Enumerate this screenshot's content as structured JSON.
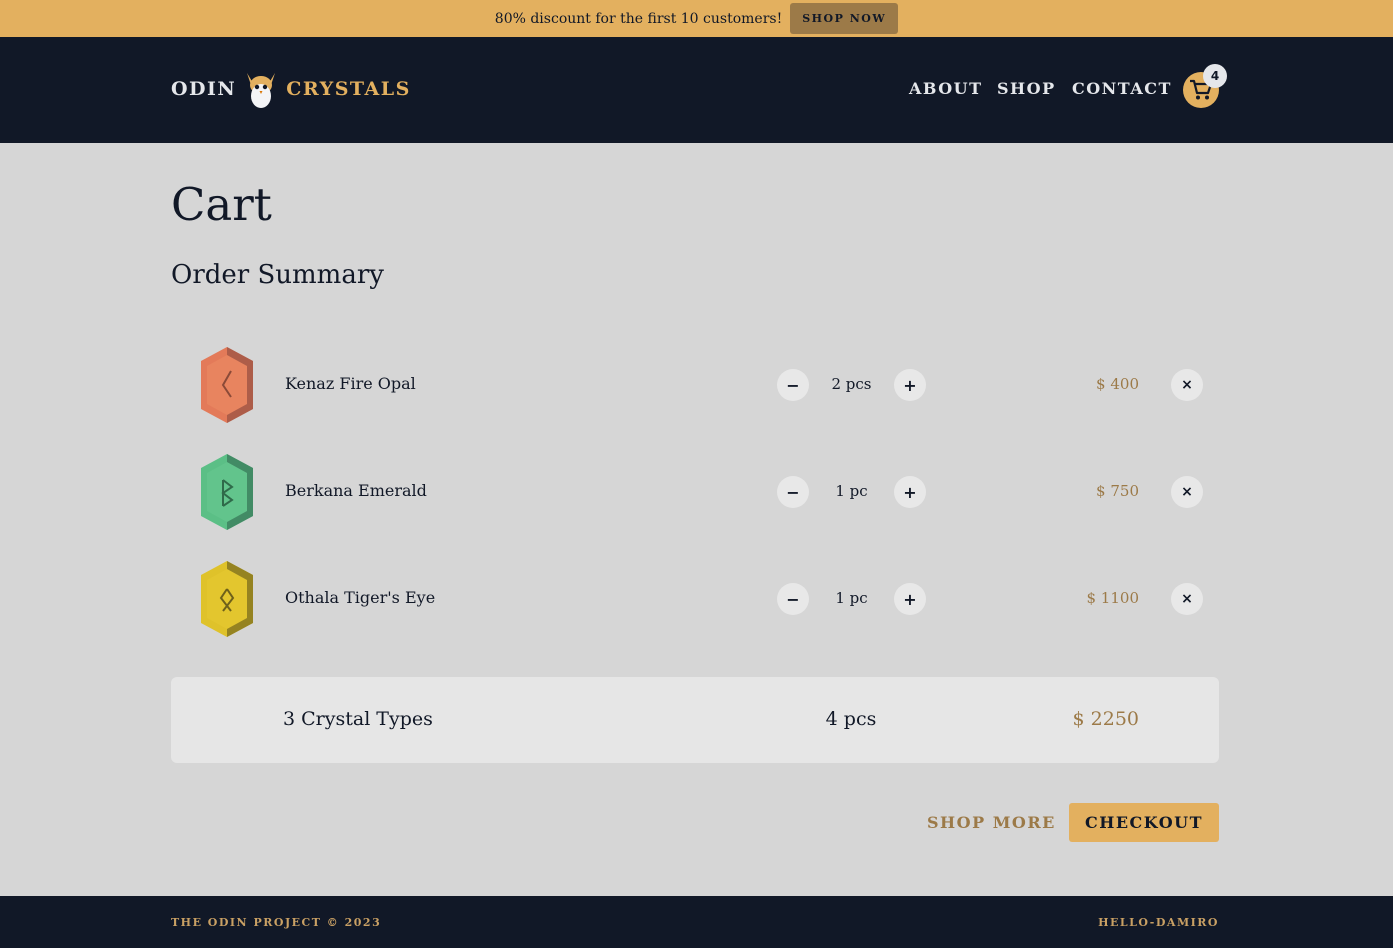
{
  "banner": {
    "text": "80% discount for the first 10 customers!",
    "button_label": "SHOP NOW"
  },
  "header": {
    "logo_left": "ODIN",
    "logo_right": "CRYSTALS",
    "nav": [
      "ABOUT",
      "SHOP",
      "CONTACT"
    ],
    "cart_count": "4",
    "mascot_icon": "viking-owl-icon",
    "cart_icon": "shopping-cart-icon"
  },
  "main": {
    "title": "Cart",
    "subtitle": "Order Summary"
  },
  "items": [
    {
      "name": "Kenaz Fire Opal",
      "qty": "2 pcs",
      "price": "$ 400",
      "gem_icon": "fire-opal-gem-icon",
      "rune": "kenaz-rune",
      "color": "#e37a59",
      "dark": "#9b5444"
    },
    {
      "name": "Berkana Emerald",
      "qty": "1 pc",
      "price": "$ 750",
      "gem_icon": "emerald-gem-icon",
      "rune": "berkana-rune",
      "color": "#5bbf86",
      "dark": "#3a7a59"
    },
    {
      "name": "Othala Tiger's Eye",
      "qty": "1 pc",
      "price": "$ 1100",
      "gem_icon": "tigers-eye-gem-icon",
      "rune": "othala-rune",
      "color": "#dfc22a",
      "dark": "#7c6e1f"
    }
  ],
  "controls": {
    "minus": "−",
    "plus": "+",
    "remove": "×"
  },
  "summary": {
    "types": "3 Crystal Types",
    "pcs": "4 pcs",
    "total": "$ 2250"
  },
  "actions": {
    "shop_more": "SHOP MORE",
    "checkout": "CHECKOUT"
  },
  "footer": {
    "left": "THE ODIN PROJECT © 2023",
    "right": "HELLO-DAMIRO"
  },
  "colors": {
    "accent": "#e3b05f",
    "dark": "#111827",
    "price": "#9c7a48",
    "background": "#d6d6d6"
  }
}
